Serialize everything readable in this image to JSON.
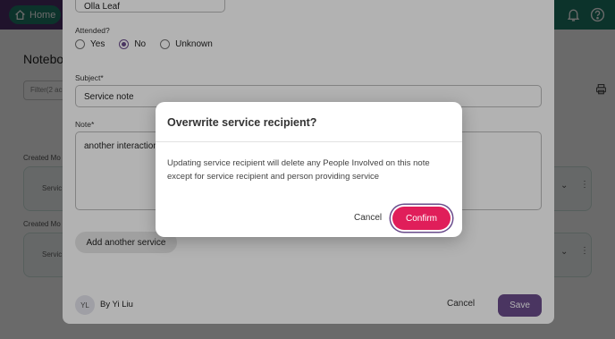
{
  "topbar": {
    "home_label": "Home",
    "notifications_icon": "bell-icon",
    "help_icon": "help-circle-icon"
  },
  "background": {
    "title": "Notebo",
    "filter_text": "Filter(2 ac",
    "print_icon": "printer-icon",
    "section_labels": [
      "Created Mo",
      "Created Mo"
    ],
    "cards": [
      {
        "text": "Servic"
      },
      {
        "text": "Servic"
      }
    ]
  },
  "form": {
    "recipient_value": "Olla Leaf",
    "attended_label": "Attended?",
    "attended_options": [
      "Yes",
      "No",
      "Unknown"
    ],
    "attended_selected": "No",
    "subject_label": "Subject",
    "subject_value": "Service note",
    "note_label": "Note",
    "note_value": "another interaction",
    "add_service_label": "Add another service",
    "author_initials": "YL",
    "author_text": "By Yi Liu",
    "cancel_label": "Cancel",
    "save_label": "Save"
  },
  "dialog": {
    "title": "Overwrite service recipient?",
    "body": "Updating service recipient will delete any People Involved on this note except for service recipient and person providing service",
    "cancel_label": "Cancel",
    "confirm_label": "Confirm"
  },
  "colors": {
    "brand_purple": "#4d2f6b",
    "accent_purple": "#6a4c8c",
    "accent_teal": "#1f7a68",
    "confirm_pink": "#e01e5a"
  }
}
